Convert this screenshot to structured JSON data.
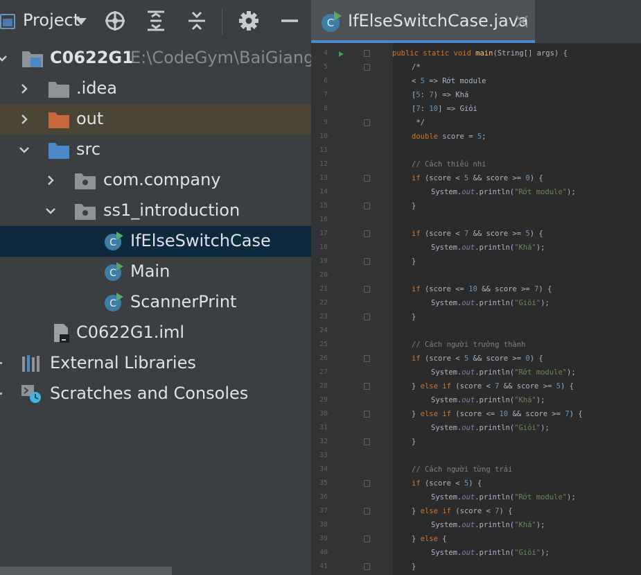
{
  "project_panel": {
    "title": "Project",
    "tree": [
      {
        "label": "C0622G1",
        "path": "E:\\CodeGym\\BaiGiang\\C"
      },
      {
        "label": ".idea"
      },
      {
        "label": "out"
      },
      {
        "label": "src"
      },
      {
        "label": "com.company"
      },
      {
        "label": "ss1_introduction"
      },
      {
        "label": "IfElseSwitchCase"
      },
      {
        "label": "Main"
      },
      {
        "label": "ScannerPrint"
      },
      {
        "label": "C0622G1.iml"
      },
      {
        "label": "External Libraries"
      },
      {
        "label": "Scratches and Consoles"
      }
    ]
  },
  "editor": {
    "tab_title": "IfElseSwitchCase.java",
    "lines": [
      {
        "n": "4",
        "text": "public static void main(String[] args) {"
      },
      {
        "n": "5",
        "text": "/*"
      },
      {
        "n": "6",
        "text": "< 5 => Rớt module"
      },
      {
        "n": "7",
        "text": "[5: 7) => Khá"
      },
      {
        "n": "8",
        "text": "[7: 10] => Giỏi"
      },
      {
        "n": "9",
        "text": " */"
      },
      {
        "n": "10",
        "text": "double score = 5;"
      },
      {
        "n": "11",
        "text": ""
      },
      {
        "n": "12",
        "text": "// Cách thiếu nhi"
      },
      {
        "n": "13",
        "text": "if (score < 5 && score >= 0) {"
      },
      {
        "n": "14",
        "text": "System.out.println(\"Rớt module\");"
      },
      {
        "n": "15",
        "text": "}"
      },
      {
        "n": "16",
        "text": ""
      },
      {
        "n": "17",
        "text": "if (score < 7 && score >= 5) {"
      },
      {
        "n": "18",
        "text": "System.out.println(\"Khá\");"
      },
      {
        "n": "19",
        "text": "}"
      },
      {
        "n": "20",
        "text": ""
      },
      {
        "n": "21",
        "text": "if (score <= 10 && score >= 7) {"
      },
      {
        "n": "22",
        "text": "System.out.println(\"Giỏi\");"
      },
      {
        "n": "23",
        "text": "}"
      },
      {
        "n": "24",
        "text": ""
      },
      {
        "n": "25",
        "text": "// Cách người trưởng thành"
      },
      {
        "n": "26",
        "text": "if (score < 5 && score >= 0) {"
      },
      {
        "n": "27",
        "text": "System.out.println(\"Rớt module\");"
      },
      {
        "n": "28",
        "text": "} else if (score < 7 && score >= 5) {"
      },
      {
        "n": "29",
        "text": "System.out.println(\"Khá\");"
      },
      {
        "n": "30",
        "text": "} else if (score <= 10 && score >= 7) {"
      },
      {
        "n": "31",
        "text": "System.out.println(\"Giỏi\");"
      },
      {
        "n": "32",
        "text": "}"
      },
      {
        "n": "33",
        "text": ""
      },
      {
        "n": "34",
        "text": "// Cách người từng trải"
      },
      {
        "n": "35",
        "text": "if (score < 5) {"
      },
      {
        "n": "36",
        "text": "System.out.println(\"Rớt module\");"
      },
      {
        "n": "37",
        "text": "} else if (score < 7) {"
      },
      {
        "n": "38",
        "text": "System.out.println(\"Khá\");"
      },
      {
        "n": "39",
        "text": "} else {"
      },
      {
        "n": "40",
        "text": "System.out.println(\"Giỏi\");"
      },
      {
        "n": "41",
        "text": "}"
      }
    ]
  },
  "colors": {
    "keyword": "#cc7832",
    "method_decl": "#ffc66d",
    "comment": "#808080",
    "number": "#6897bb",
    "string": "#6a8759",
    "static_field": "#9876aa",
    "selection": "#0d293e",
    "tab_underline": "#4a88c7"
  }
}
